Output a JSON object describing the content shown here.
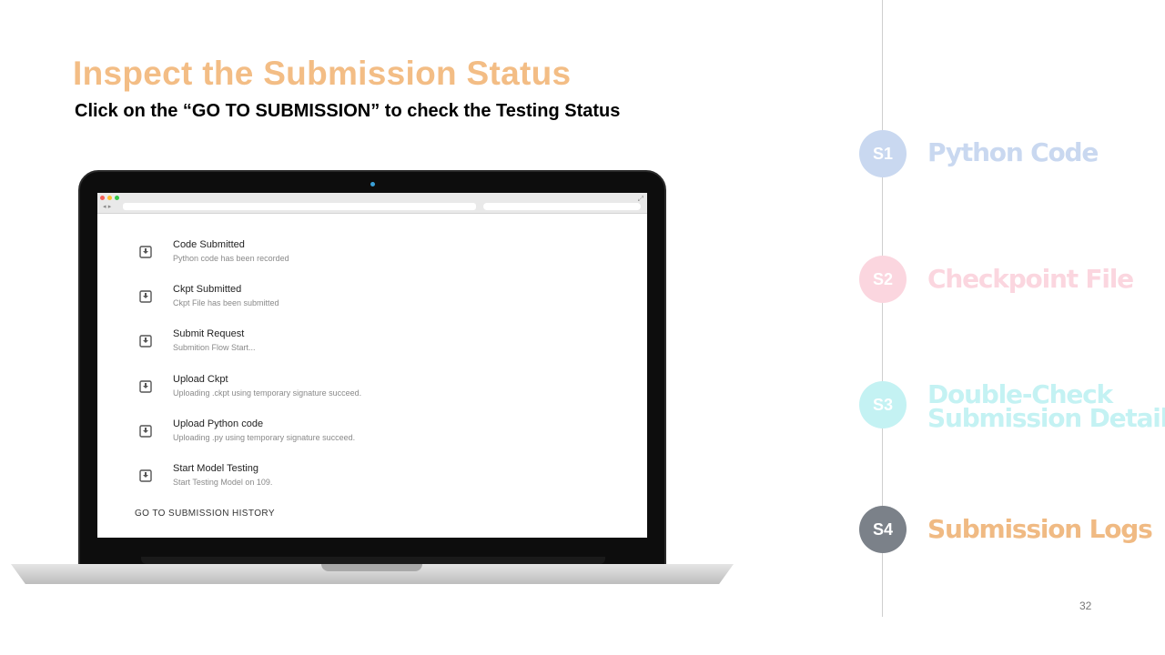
{
  "slide": {
    "title": "Inspect the Submission Status",
    "subtitle": "Click on the “GO TO SUBMISSION”  to check the Testing Status",
    "page_number": "32"
  },
  "colors": {
    "title": "#f3bd85",
    "s1": "#c9d8f0",
    "s2": "#fbd6df",
    "s3": "#c4f2f3",
    "s4_circle": "#7b8189",
    "s4_label": "#f0ba83"
  },
  "screen": {
    "logs": [
      {
        "title": "Code Submitted",
        "desc": "Python code has been recorded",
        "icon": "download-icon"
      },
      {
        "title": "Ckpt Submitted",
        "desc": "Ckpt File has been submitted",
        "icon": "download-icon"
      },
      {
        "title": "Submit Request",
        "desc": "Submition Flow Start...",
        "icon": "download-icon"
      },
      {
        "title": "Upload Ckpt",
        "desc": "Uploading .ckpt using temporary signature succeed.",
        "icon": "download-icon"
      },
      {
        "title": "Upload Python code",
        "desc": "Uploading .py using temporary signature succeed.",
        "icon": "download-icon"
      },
      {
        "title": "Start Model Testing",
        "desc": "Start Testing Model on 109.",
        "icon": "download-icon"
      }
    ],
    "history_link": "GO TO SUBMISSION HISTORY"
  },
  "steps": [
    {
      "badge": "S1",
      "label_line1": "Python Code",
      "label_line2": ""
    },
    {
      "badge": "S2",
      "label_line1": "Checkpoint File",
      "label_line2": ""
    },
    {
      "badge": "S3",
      "label_line1": "Double-Check",
      "label_line2": "Submission Detail"
    },
    {
      "badge": "S4",
      "label_line1": "Submission Logs",
      "label_line2": ""
    }
  ]
}
